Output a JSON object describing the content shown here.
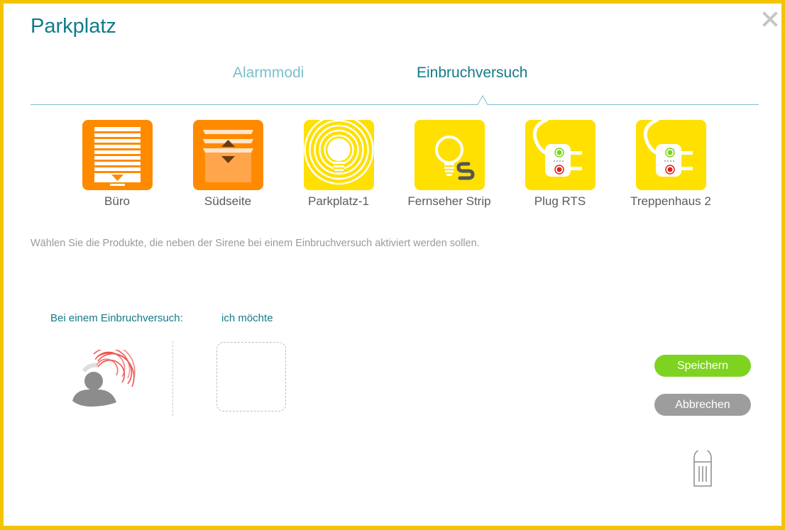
{
  "dialog": {
    "title": "Parkplatz",
    "close_icon": "close-icon"
  },
  "tabs": [
    {
      "label": "Alarmmodi",
      "active": false
    },
    {
      "label": "Einbruchversuch",
      "active": true
    }
  ],
  "devices": [
    {
      "label": "Büro",
      "icon": "blind-down-icon",
      "color": "#ff8a00"
    },
    {
      "label": "Südseite",
      "icon": "blind-up-down-icon",
      "color": "#ff8a00"
    },
    {
      "label": "Parkplatz-1",
      "icon": "light-bulb-icon",
      "color": "#ffe000"
    },
    {
      "label": "Fernseher Strip",
      "icon": "light-strip-icon",
      "color": "#ffe000"
    },
    {
      "label": "Plug RTS",
      "icon": "plug-icon",
      "color": "#ffe000"
    },
    {
      "label": "Treppenhaus 2",
      "icon": "plug-icon",
      "color": "#ffe000"
    }
  ],
  "hint": "Wählen Sie die Produkte, die neben der Sirene bei einem Einbruchversuch aktiviert werden sollen.",
  "scenario": {
    "trigger_label": "Bei einem Einbruchversuch:",
    "action_label": "ich möchte",
    "trigger_icon": "intrusion-siren-icon",
    "dropzone": "empty"
  },
  "actions": {
    "save_label": "Speichern",
    "cancel_label": "Abbrechen",
    "delete_icon": "trash-icon"
  },
  "colors": {
    "frame": "#f5c400",
    "accent": "#127a8a",
    "save": "#7ed321",
    "cancel": "#9d9d9d"
  }
}
